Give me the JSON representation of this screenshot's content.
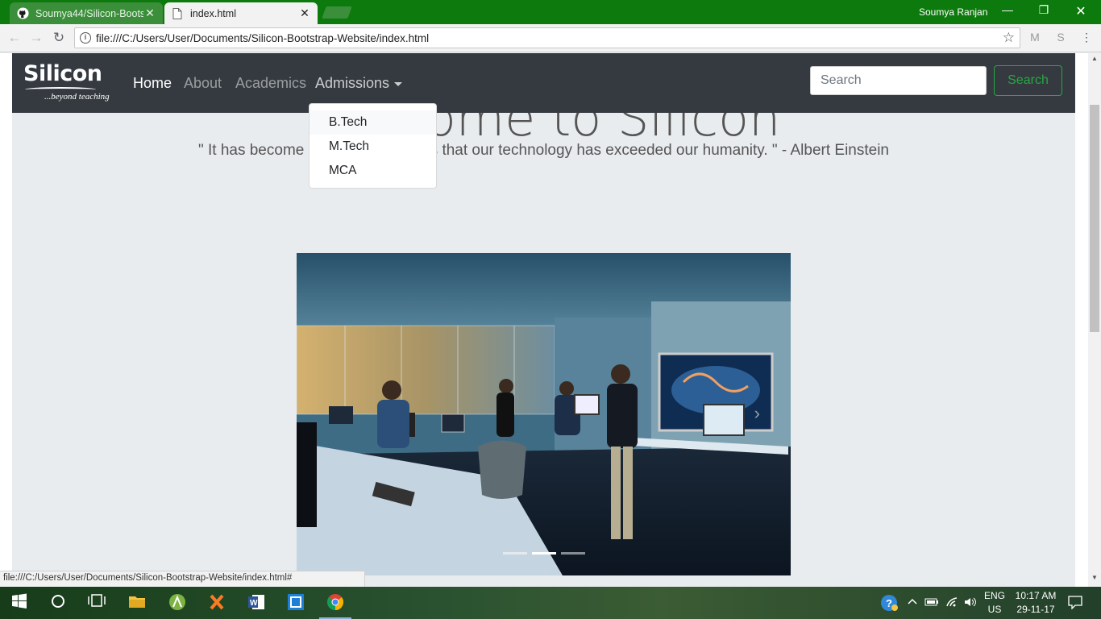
{
  "browser": {
    "tabs": [
      {
        "title": "Soumya44/Silicon-Bootst",
        "active": false,
        "icon": "github-icon"
      },
      {
        "title": "index.html",
        "active": true,
        "icon": "document-icon"
      }
    ],
    "profile_name": "Soumya Ranjan",
    "url": "file:///C:/Users/User/Documents/Silicon-Bootstrap-Website/index.html",
    "status_url": "file:///C:/Users/User/Documents/Silicon-Bootstrap-Website/index.html#"
  },
  "navbar": {
    "brand": {
      "name": "Silicon",
      "tagline": "...beyond teaching"
    },
    "links": [
      {
        "label": "Home",
        "active": true
      },
      {
        "label": "About",
        "active": false
      },
      {
        "label": "Academics",
        "active": false
      },
      {
        "label": "Admissions",
        "active": false
      }
    ],
    "search_placeholder": "Search",
    "search_button": "Search"
  },
  "admissions_dropdown": {
    "items": [
      "B.Tech",
      "M.Tech",
      "MCA"
    ]
  },
  "hero": {
    "heading": "Welcome to Silicon",
    "quote": "\" It has become appallingly obvious that our technology has exceeded our humanity. \" - Albert Einstein"
  },
  "carousel": {
    "slide_count": 3,
    "active_index": 1
  },
  "taskbar": {
    "language": "ENG",
    "region": "US",
    "time": "10:17 AM",
    "date": "29-11-17"
  },
  "colors": {
    "chrome_frame": "#0d7a0d",
    "navbar_bg": "#343a40",
    "jumbotron_bg": "#e9ecef",
    "success": "#28a745"
  }
}
